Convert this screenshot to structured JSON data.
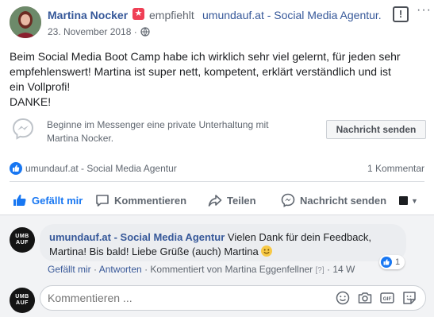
{
  "post": {
    "author": "Martina Nocker",
    "recommends_text": "empfiehlt",
    "page_name": "umundauf.at - Social Media Agentur.",
    "date": "23. November 2018 ·",
    "text_lines": [
      "Beim Social Media Boot Camp habe ich wirklich sehr viel gelernt, für jeden sehr",
      "empfehlenswert! Martina ist super nett, kompetent, erklärt verständlich und ist",
      "ein Vollprofi!",
      "DANKE!"
    ]
  },
  "messenger": {
    "prompt_line1": "Beginne im Messenger eine private Unterhaltung mit",
    "prompt_line2": "Martina Nocker.",
    "button_label": "Nachricht senden"
  },
  "summary": {
    "liked_by": "umundauf.at - Social Media Agentur",
    "comment_count": "1 Kommentar"
  },
  "actions": {
    "like": "Gefällt mir",
    "comment": "Kommentieren",
    "share": "Teilen",
    "send": "Nachricht senden"
  },
  "comment": {
    "avatar_text": "UMB\nAUF",
    "author": "umundauf.at - Social Media Agentur",
    "text_part1": "Vielen Dank für dein Feedback,",
    "text_part2": "Martina! Bis bald! Liebe Grüße (auch) Martina",
    "reaction_count": "1",
    "meta_like": "Gefällt mir",
    "meta_sep1": " · ",
    "meta_reply": "Antworten",
    "meta_sep2": " · ",
    "meta_commented_by": "Kommentiert von Martina Eggenfellner",
    "meta_help": "[?]",
    "meta_time": " · 14 W"
  },
  "reply": {
    "placeholder": "Kommentieren ..."
  },
  "colors": {
    "link": "#365899",
    "accent": "#1877f2",
    "recommend_star": "#ef3f55"
  }
}
